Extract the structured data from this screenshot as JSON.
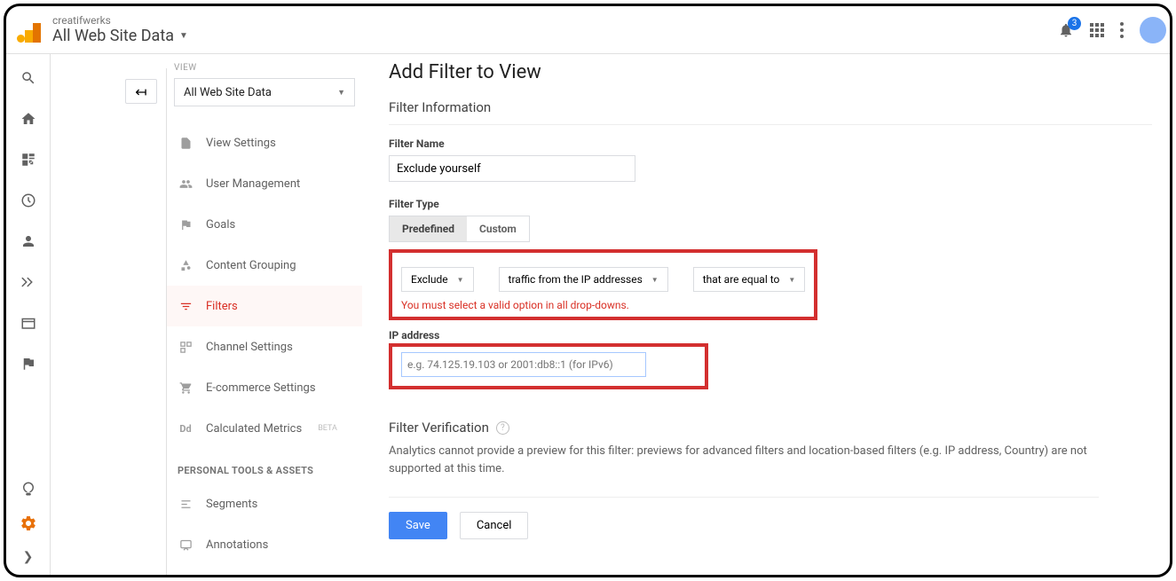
{
  "header": {
    "account": "creatifwerks",
    "view": "All Web Site Data",
    "notification_count": "3"
  },
  "view_panel": {
    "label": "VIEW",
    "selected": "All Web Site Data"
  },
  "nav": {
    "items": [
      {
        "label": "View Settings"
      },
      {
        "label": "User Management"
      },
      {
        "label": "Goals"
      },
      {
        "label": "Content Grouping"
      },
      {
        "label": "Filters"
      },
      {
        "label": "Channel Settings"
      },
      {
        "label": "E-commerce Settings"
      },
      {
        "label": "Calculated Metrics",
        "beta": "BETA"
      }
    ],
    "section": "PERSONAL TOOLS & ASSETS",
    "personal": [
      {
        "label": "Segments"
      },
      {
        "label": "Annotations"
      }
    ]
  },
  "form": {
    "title": "Add Filter to View",
    "info_heading": "Filter Information",
    "name_label": "Filter Name",
    "name_value": "Exclude yourself",
    "type_label": "Filter Type",
    "tab_predefined": "Predefined",
    "tab_custom": "Custom",
    "dd1": "Exclude",
    "dd2": "traffic from the IP addresses",
    "dd3": "that are equal to",
    "error": "You must select a valid option in all drop-downs.",
    "ip_label": "IP address",
    "ip_placeholder": "e.g. 74.125.19.103 or 2001:db8::1 (for IPv6)",
    "verif_heading": "Filter Verification",
    "verif_text": "Analytics cannot provide a preview for this filter: previews for advanced filters and location-based filters (e.g. IP address, Country) are not supported at this time.",
    "save": "Save",
    "cancel": "Cancel"
  }
}
